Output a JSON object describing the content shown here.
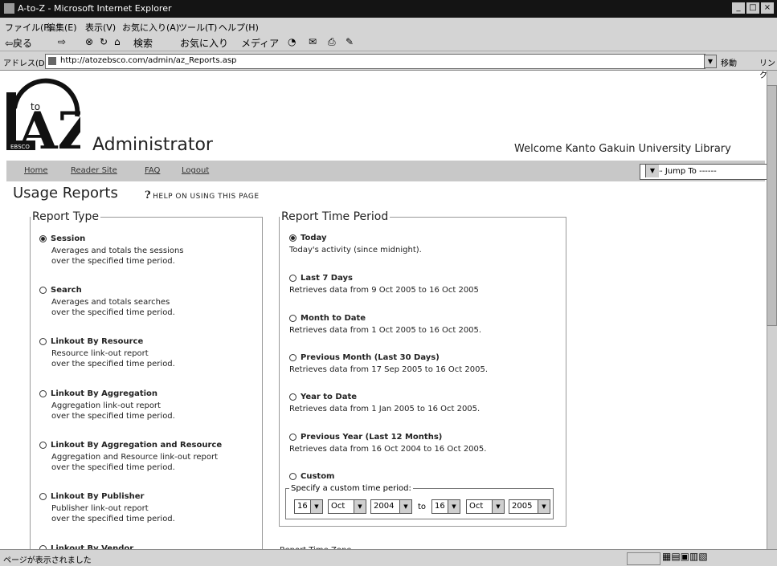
{
  "window": {
    "title": "A-to-Z - Microsoft Internet Explorer",
    "buttons": [
      "_",
      "□",
      "×"
    ]
  },
  "menu": [
    "ファイル(F)",
    "編集(E)",
    "表示(V)",
    "お気に入り(A)",
    "ツール(T)",
    "ヘルプ(H)"
  ],
  "toolbar": {
    "back": "⇦戻る",
    "forward": "⇨",
    "search": "検索",
    "favorites": "お気に入り",
    "media": "メディア"
  },
  "address": {
    "label": "アドレス(D)",
    "url": "http://atozebsco.com/admin/az_Reports.asp",
    "go": "移動",
    "links": "リンク"
  },
  "logo": {
    "text": "AtoZ",
    "small": "to",
    "badge": "EBSCO"
  },
  "header": {
    "title": "Administrator",
    "welcome": "Welcome Kanto Gakuin University Library"
  },
  "nav": {
    "links": [
      "Home",
      "Reader Site",
      "FAQ",
      "Logout"
    ],
    "jump": "------ Jump To ------"
  },
  "page": {
    "title": "Usage Reports",
    "help": "HELP ON USING THIS PAGE"
  },
  "report_type": {
    "legend": "Report Type",
    "options": [
      {
        "label": "Session",
        "desc1": "Averages and totals the sessions",
        "desc2": "over the specified time period.",
        "checked": true
      },
      {
        "label": "Search",
        "desc1": "Averages and totals searches",
        "desc2": "over the specified time period.",
        "checked": false
      },
      {
        "label": "Linkout By Resource",
        "desc1": "Resource link-out report",
        "desc2": "over the specified time period.",
        "checked": false
      },
      {
        "label": "Linkout By Aggregation",
        "desc1": "Aggregation link-out report",
        "desc2": "over the specified time period.",
        "checked": false
      },
      {
        "label": "Linkout By Aggregation and Resource",
        "desc1": "Aggregation and Resource link-out report",
        "desc2": "over the specified time period.",
        "checked": false
      },
      {
        "label": "Linkout By Publisher",
        "desc1": "Publisher link-out report",
        "desc2": "over the specified time period.",
        "checked": false
      },
      {
        "label": "Linkout By Vendor",
        "checked": false
      }
    ]
  },
  "time_period": {
    "legend": "Report Time Period",
    "options": [
      {
        "label": "Today",
        "desc": "Today's activity (since midnight).",
        "checked": true
      },
      {
        "label": "Last 7 Days",
        "desc": "Retrieves data from 9 Oct 2005 to 16 Oct 2005",
        "checked": false
      },
      {
        "label": "Month to Date",
        "desc": "Retrieves data from 1 Oct 2005 to 16 Oct 2005.",
        "checked": false
      },
      {
        "label": "Previous Month (Last 30 Days)",
        "desc": "Retrieves data from 17 Sep 2005 to 16 Oct 2005.",
        "checked": false
      },
      {
        "label": "Year to Date",
        "desc": "Retrieves data from 1 Jan 2005 to 16 Oct 2005.",
        "checked": false
      },
      {
        "label": "Previous Year (Last 12 Months)",
        "desc": "Retrieves data from 16 Oct 2004 to 16 Oct 2005.",
        "checked": false
      },
      {
        "label": "Custom",
        "checked": false
      }
    ],
    "custom": {
      "legend": "Specify a custom time period:",
      "from": {
        "day": "16",
        "month": "Oct",
        "year": "2004"
      },
      "to_label": "to",
      "to": {
        "day": "16",
        "month": "Oct",
        "year": "2005"
      }
    }
  },
  "time_zone": "Report Time Zone",
  "status": {
    "text": "ページが表示されました"
  }
}
